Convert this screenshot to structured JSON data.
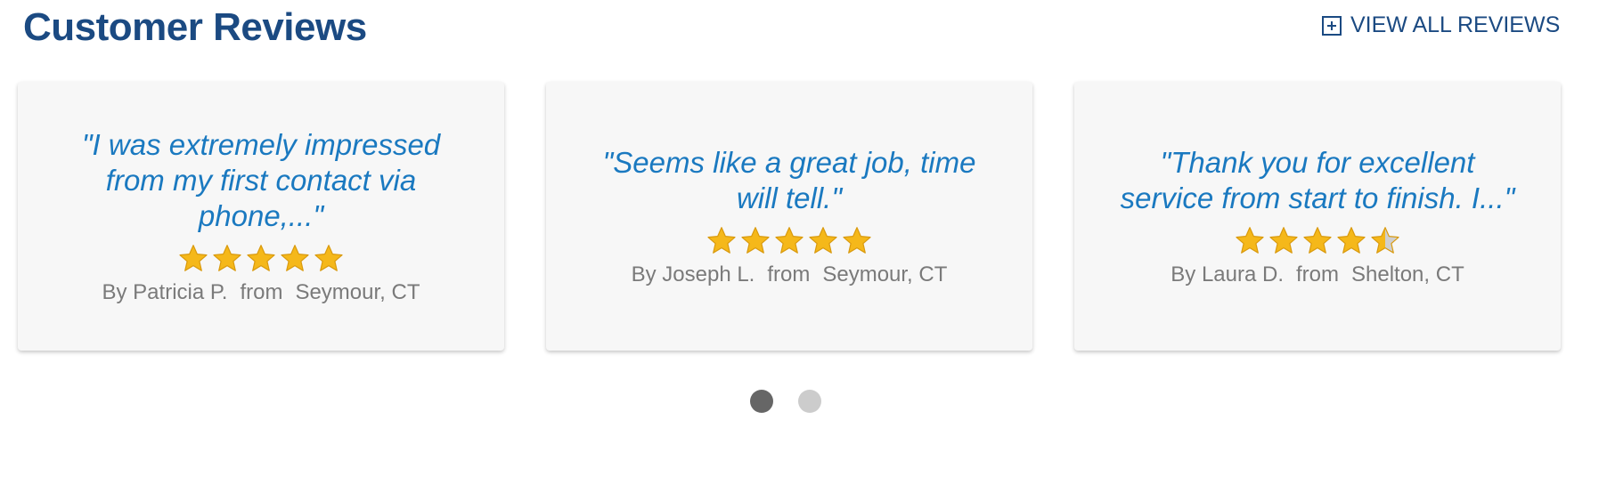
{
  "header": {
    "title": "Customer Reviews",
    "view_all_label": "VIEW ALL REVIEWS"
  },
  "colors": {
    "title": "#1b4a82",
    "quote": "#1a79c0",
    "byline": "#7a7a7a",
    "card_bg": "#f7f7f7",
    "star_gold": "#f5b81a",
    "star_gray": "#cfcfcf",
    "dot_active": "#666666",
    "dot_inactive": "#cccccc"
  },
  "reviews": [
    {
      "quote": "\"I was extremely impressed from my first contact via phone,...\"",
      "rating": 5,
      "by": "By Patricia P.",
      "from_label": "from",
      "location": "Seymour, CT"
    },
    {
      "quote": "\"Seems like a great job, time will tell.\"",
      "rating": 5,
      "by": "By Joseph L.",
      "from_label": "from",
      "location": "Seymour, CT"
    },
    {
      "quote": "\"Thank you for excellent service from start to finish. I...\"",
      "rating": 4.5,
      "by": "By Laura D.",
      "from_label": "from",
      "location": "Shelton, CT"
    }
  ],
  "carousel": {
    "pages": 2,
    "active_index": 0
  }
}
